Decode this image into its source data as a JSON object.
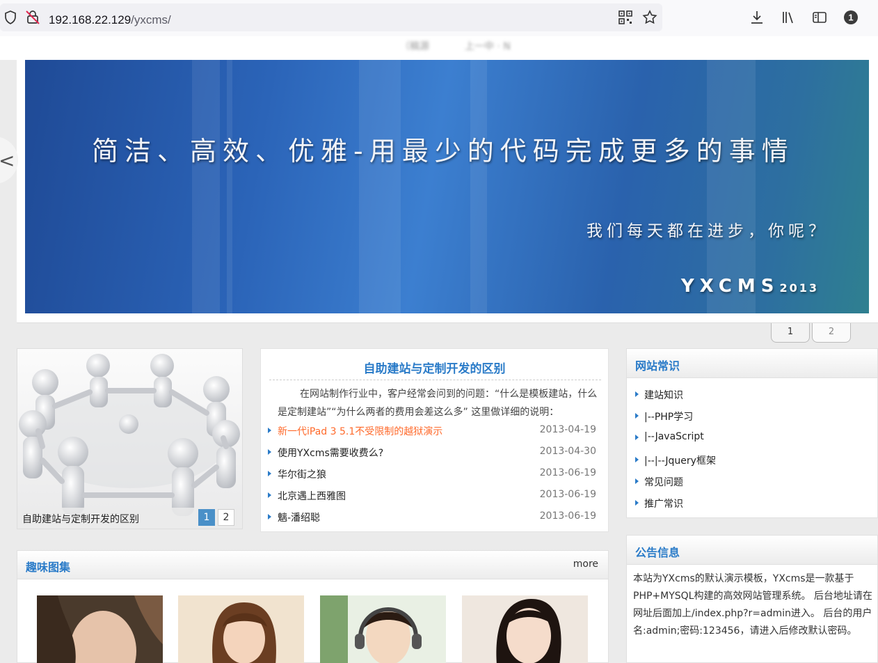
{
  "browser": {
    "url_host": "192.168.22.129",
    "url_path": "/yxcms/",
    "ghost_tabs": [
      "（稿源",
      "上一中 · N"
    ]
  },
  "banner": {
    "title": "简洁、高效、优雅-用最少的代码完成更多的事情",
    "subtitle": "我们每天都在进步，你呢？",
    "brand": "YXCMS",
    "brand_year": "2013",
    "pages": [
      "1",
      "2"
    ],
    "prev_glyph": "<"
  },
  "feature": {
    "caption": "自助建站与定制开发的区别",
    "pages": [
      "1",
      "2"
    ],
    "active_page": 1
  },
  "article": {
    "title": "自助建站与定制开发的区别",
    "intro": "在网站制作行业中，客户经常会问到的问题：“什么是模板建站，什么是定制建站”“为什么两者的费用会差这么多” 这里做详细的说明：",
    "news": [
      {
        "title": "新一代iPad 3 5.1不受限制的越狱演示",
        "date": "2013-04-19",
        "hot": true
      },
      {
        "title": "使用YXcms需要收费么?",
        "date": "2013-04-30",
        "hot": false
      },
      {
        "title": "华尔街之狼",
        "date": "2013-06-19",
        "hot": false
      },
      {
        "title": "北京遇上西雅图",
        "date": "2013-06-19",
        "hot": false
      },
      {
        "title": "魑-潘绍聪",
        "date": "2013-06-19",
        "hot": false
      }
    ]
  },
  "knowledge": {
    "heading": "网站常识",
    "items": [
      "建站知识",
      "|--PHP学习",
      "|--JavaScript",
      "|--|--Jquery框架",
      "常见问题",
      "推广常识"
    ]
  },
  "notice": {
    "heading": "公告信息",
    "text": "本站为YXcms的默认演示模板，YXcms是一款基于PHP+MYSQL构建的高效网站管理系统。 后台地址请在网址后面加上/index.php?r=admin进入。 后台的用户名:admin;密码:123456，请进入后修改默认密码。"
  },
  "gallery": {
    "heading": "趣味图集",
    "more": "more"
  },
  "colors": {
    "accent": "#2a7bc8",
    "hot_link": "#ff6a2b",
    "banner_blue": "#2b64b8"
  }
}
